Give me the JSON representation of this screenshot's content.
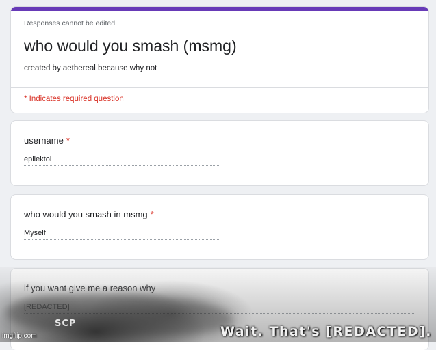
{
  "header": {
    "notice": "Responses cannot be edited",
    "title": "who would you smash (msmg)",
    "description": "created by aethereal because why not",
    "required_note": "* Indicates required question"
  },
  "questions": [
    {
      "title": "username",
      "required_mark": "*",
      "answer": "epilektoi"
    },
    {
      "title": "who would you smash in msmg",
      "required_mark": "*",
      "answer": "Myself"
    },
    {
      "title": "if you want give me a reason why",
      "answer": "[REDACTED]"
    }
  ],
  "meme": {
    "logo_text": "SCP",
    "caption": "Wait. That's [REDACTED]."
  },
  "watermark": "imgflip.com",
  "colors": {
    "accent": "#673ab7",
    "required": "#d93025"
  }
}
